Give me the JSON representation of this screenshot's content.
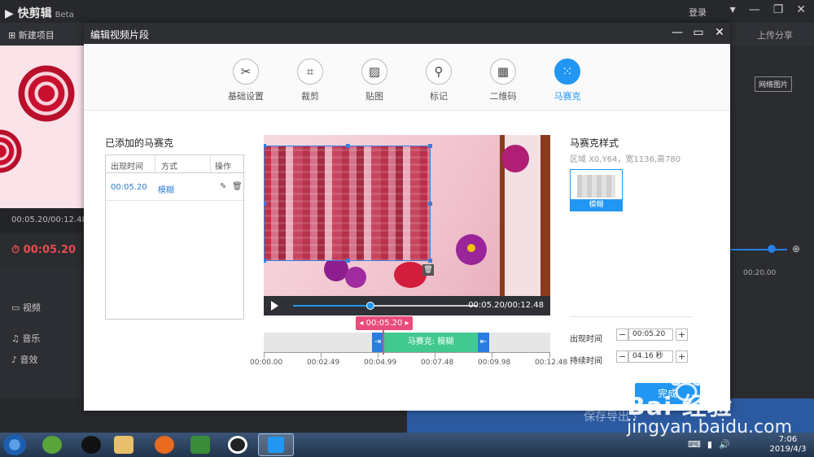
{
  "app": {
    "name": "快剪辑",
    "beta": "Beta",
    "login": "登录",
    "new_project": "新建项目",
    "share": "上传分享",
    "network_image": "网络图片",
    "timecode": "00:05.20/00:12.48",
    "current_time": "00:05.20",
    "ruler_mark": "00:20.00",
    "tracks": {
      "video": "视频",
      "music": "音乐",
      "sfx": "音效"
    },
    "export_label": "保存导出"
  },
  "dialog": {
    "title": "编辑视频片段",
    "tabs": [
      {
        "label": "基础设置",
        "icon": "scissors-icon"
      },
      {
        "label": "裁剪",
        "icon": "crop-icon"
      },
      {
        "label": "贴图",
        "icon": "image-icon"
      },
      {
        "label": "标记",
        "icon": "pin-icon"
      },
      {
        "label": "二维码",
        "icon": "qrcode-icon"
      },
      {
        "label": "马赛克",
        "icon": "mosaic-icon",
        "active": true
      }
    ],
    "added_title": "已添加的马赛克",
    "table": {
      "headers": [
        "出现时间",
        "方式",
        "操作"
      ],
      "rows": [
        {
          "time": "00:05.20",
          "method": "模糊"
        }
      ]
    },
    "player": {
      "time_readout": "00:05.20/00:12.48",
      "progress": 0.42
    },
    "timeline": {
      "current_label": "00:05.20",
      "clip_label": "马赛克: 模糊",
      "ticks": [
        "00:00.00",
        "00:02.49",
        "00:04.99",
        "00:07.48",
        "00:09.98",
        "00:12.48"
      ]
    },
    "style_title": "马赛克样式",
    "region_info": "区域 X0,Y64，宽1136,高780",
    "style_option": "模糊",
    "appear_label": "出现时间",
    "appear_value": "00:05.20",
    "duration_label": "持续时间",
    "duration_value": "04.16 秒",
    "done_label": "完成"
  },
  "taskbar": {
    "time": "7:06",
    "date": "2019/4/3"
  },
  "watermark": {
    "line1": "Bai 经验",
    "line2": "jingyan.baidu.com"
  },
  "colors": {
    "accent": "#2196f3",
    "clip_green": "#41c98f",
    "marker_pink": "#e84c7c"
  }
}
